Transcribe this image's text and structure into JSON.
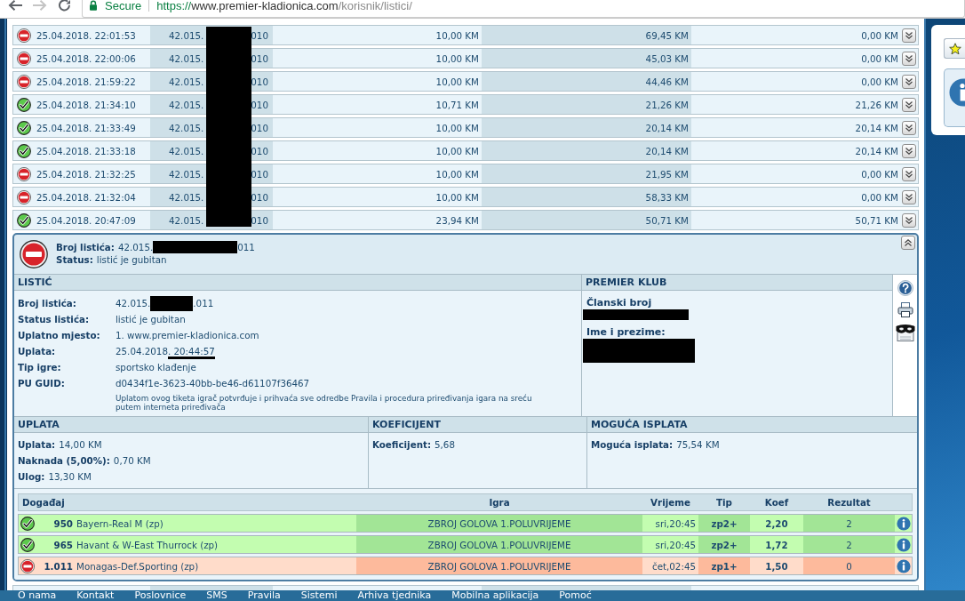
{
  "browser": {
    "security_label": "Secure",
    "url_scheme": "https://",
    "url_host": "www.premier-kladionica.com",
    "url_path": "/korisnik/listici/"
  },
  "ticket_list": {
    "number_redacted": true,
    "rows": [
      {
        "won": false,
        "datetime": "25.04.2018. 22:01:53",
        "number_start": "42.015.",
        "number_end": "010",
        "column_3": "10,00 KM",
        "column_4": "69,45 KM",
        "column_5": "0,00 KM",
        "expanded": false
      },
      {
        "won": false,
        "datetime": "25.04.2018. 22:00:06",
        "number_start": "42.015.",
        "number_end": "010",
        "column_3": "10,00 KM",
        "column_4": "45,03 KM",
        "column_5": "0,00 KM",
        "expanded": false
      },
      {
        "won": false,
        "datetime": "25.04.2018. 21:59:22",
        "number_start": "42.015.",
        "number_end": "010",
        "column_3": "10,00 KM",
        "column_4": "44,46 KM",
        "column_5": "0,00 KM",
        "expanded": false
      },
      {
        "won": true,
        "datetime": "25.04.2018. 21:34:10",
        "number_start": "42.015.",
        "number_end": "010",
        "column_3": "10,71 KM",
        "column_4": "21,26 KM",
        "column_5": "21,26 KM",
        "expanded": false
      },
      {
        "won": true,
        "datetime": "25.04.2018. 21:33:49",
        "number_start": "42.015.",
        "number_end": "010",
        "column_3": "10,00 KM",
        "column_4": "20,14 KM",
        "column_5": "20,14 KM",
        "expanded": false
      },
      {
        "won": true,
        "datetime": "25.04.2018. 21:33:18",
        "number_start": "42.015.",
        "number_end": "010",
        "column_3": "10,00 KM",
        "column_4": "20,14 KM",
        "column_5": "20,14 KM",
        "expanded": false
      },
      {
        "won": false,
        "datetime": "25.04.2018. 21:32:25",
        "number_start": "42.015.",
        "number_end": "010",
        "column_3": "10,00 KM",
        "column_4": "21,95 KM",
        "column_5": "0,00 KM",
        "expanded": false
      },
      {
        "won": false,
        "datetime": "25.04.2018. 21:32:04",
        "number_start": "42.015.",
        "number_end": "010",
        "column_3": "10,00 KM",
        "column_4": "58,33 KM",
        "column_5": "0,00 KM",
        "expanded": false
      },
      {
        "won": true,
        "datetime": "25.04.2018. 20:47:09",
        "number_start": "42.015.",
        "number_end": "010",
        "column_3": "23,94 KM",
        "column_4": "50,71 KM",
        "column_5": "50,71 KM",
        "expanded": false
      }
    ]
  },
  "ticket_detail": {
    "won": false,
    "expanded": true,
    "summary": [
      {
        "kind": "redacted_number",
        "label": "Broj listića:",
        "start": "42.015.",
        "end": "011"
      },
      {
        "kind": "text",
        "label": "Status:",
        "value": "listić je gubitan"
      }
    ],
    "listic": {
      "title": "LISTIĆ",
      "fields": [
        {
          "kind": "redacted_number",
          "label": "Broj listića:",
          "start": "42.015.",
          "end": ".011"
        },
        {
          "kind": "text",
          "label": "Status listića:",
          "value": "listić je gubitan"
        },
        {
          "kind": "text",
          "label": "Uplatno mjesto:",
          "value": "1. www.premier-kladionica.com"
        },
        {
          "kind": "marked",
          "label": "Uplata:",
          "value": "25.04.2018",
          "marked_part": ". 20:44:57"
        },
        {
          "kind": "text",
          "label": "Tip igre:",
          "value": "sportsko klađenje"
        },
        {
          "kind": "text",
          "label": "PU GUID:",
          "value": "d0434f1e-3623-40bb-be46-d61107f36467"
        }
      ],
      "note": "Uplatom ovog tiketa igrač potvrđuje i prihvaća sve odredbe Pravila i procedura priređivanja igara na sreću putem interneta priređivača"
    },
    "premier_klub": {
      "title": "PREMIER KLUB",
      "fields": [
        {
          "kind": "redacted_line",
          "label": "Članski broj"
        },
        {
          "kind": "redacted_block",
          "label": "Ime i prezime:"
        }
      ]
    },
    "payment": [
      {
        "title": "UPLATA",
        "fields": [
          {
            "label": "Uplata:",
            "value": "14,00 KM"
          },
          {
            "label": "Naknada (5,00%):",
            "value": "0,70 KM"
          },
          {
            "label": "Ulog:",
            "value": "13,30 KM"
          }
        ]
      },
      {
        "title": "KOEFICIJENT",
        "fields": [
          {
            "label": "Koeficijent:",
            "value": "5,68"
          }
        ]
      },
      {
        "title": "MOGUĆA ISPLATA",
        "fields": [
          {
            "label": "Moguća isplata:",
            "value": "75,54 KM"
          }
        ]
      }
    ],
    "events": {
      "columns": [
        "Događaj",
        "Igra",
        "Vrijeme",
        "Tip",
        "Koef",
        "Rezultat"
      ],
      "rows": [
        {
          "won": true,
          "number": "950",
          "name": "Bayern-Real M (zp)",
          "game": "ZBROJ GOLOVA 1.POLUVRIJEME",
          "time": "sri,20:45",
          "tip": "zp2+",
          "odds": "2,20",
          "result": "2"
        },
        {
          "won": true,
          "number": "965",
          "name": "Havant & W-East Thurrock (zp)",
          "game": "ZBROJ GOLOVA 1.POLUVRIJEME",
          "time": "sri,20:45",
          "tip": "zp2+",
          "odds": "1,72",
          "result": "2"
        },
        {
          "won": false,
          "number": "1.011",
          "name": "Monagas-Def.Sporting (zp)",
          "game": "ZBROJ GOLOVA 1.POLUVRIJEME",
          "time": "čet,02:45",
          "tip": "zp1+",
          "odds": "1,50",
          "result": "0"
        }
      ]
    }
  },
  "footer_nav": {
    "items": [
      "O nama",
      "Kontakt",
      "Poslovnice",
      "SMS",
      "Pravila",
      "Sistemi",
      "Arhiva tjednika",
      "Mobilna aplikacija",
      "Pomoć"
    ]
  }
}
